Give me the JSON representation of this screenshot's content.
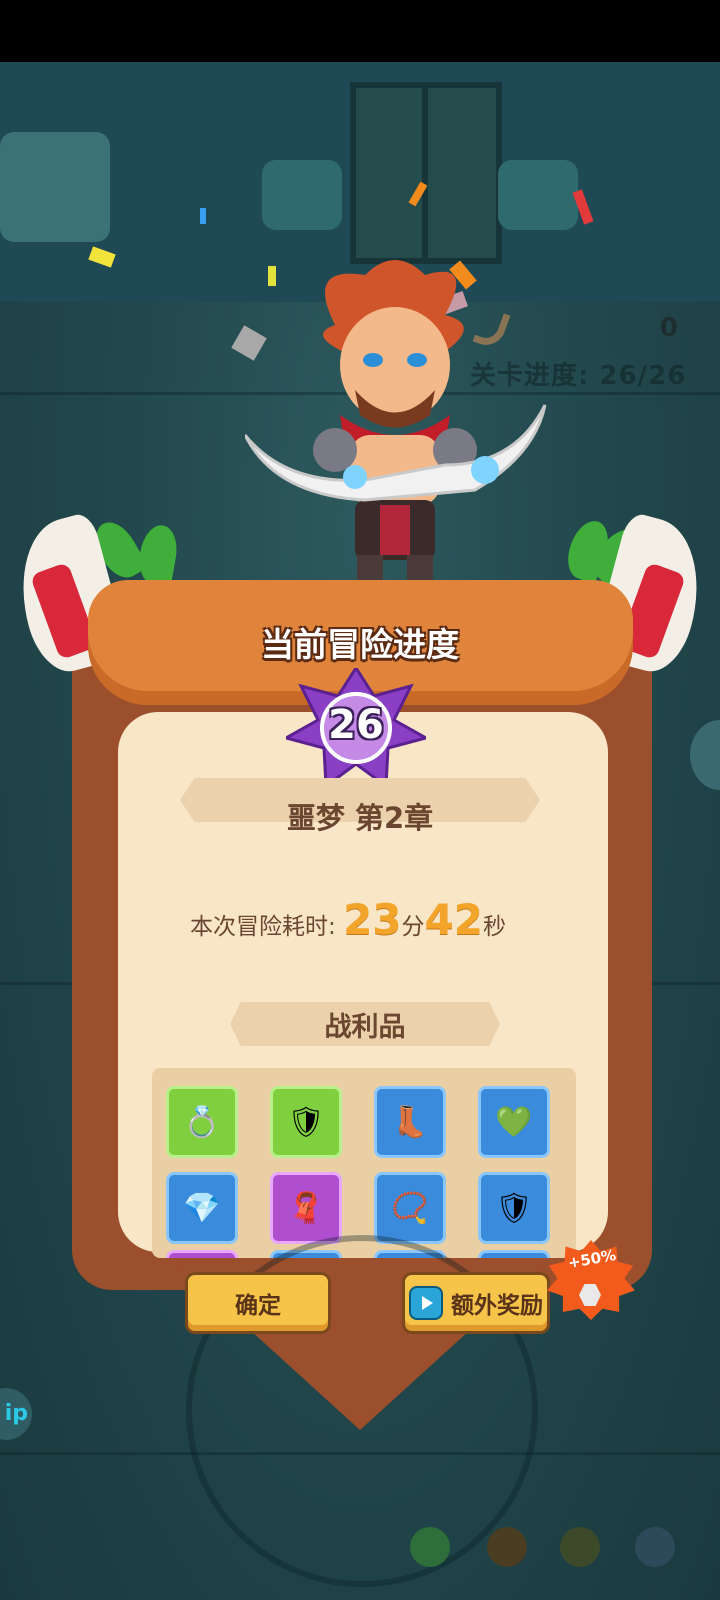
{
  "hud": {
    "counter_value": "0",
    "level_progress": "关卡进度: 26/26"
  },
  "result_panel": {
    "title": "当前冒险进度",
    "level_number": "26",
    "chapter": "噩梦 第2章",
    "time_label": "本次冒险耗时:",
    "minutes": "23",
    "minutes_unit": "分",
    "seconds": "42",
    "seconds_unit": "秒",
    "loot_title": "战利品",
    "loot_items": [
      {
        "icon": "ring-red-gem",
        "rarity": "green"
      },
      {
        "icon": "armor-pants",
        "rarity": "green"
      },
      {
        "icon": "pink-boots",
        "rarity": "blue"
      },
      {
        "icon": "ring-green-gem",
        "rarity": "blue"
      },
      {
        "icon": "blue-crystal",
        "rarity": "blue"
      },
      {
        "icon": "red-scarf",
        "rarity": "purple"
      },
      {
        "icon": "fish-necklace",
        "rarity": "blue"
      },
      {
        "icon": "armor-pants",
        "rarity": "blue"
      }
    ]
  },
  "buttons": {
    "confirm_label": "确定",
    "bonus_label": "额外奖励",
    "bonus_badge": "+50%"
  },
  "side_button_label": "ip",
  "colors": {
    "accent_gold": "#f2a52a",
    "panel_bg": "#f8e6c6",
    "wood": "#9c4f2c",
    "button_yellow": "#f7c44a",
    "burst_orange": "#f25b1c"
  }
}
